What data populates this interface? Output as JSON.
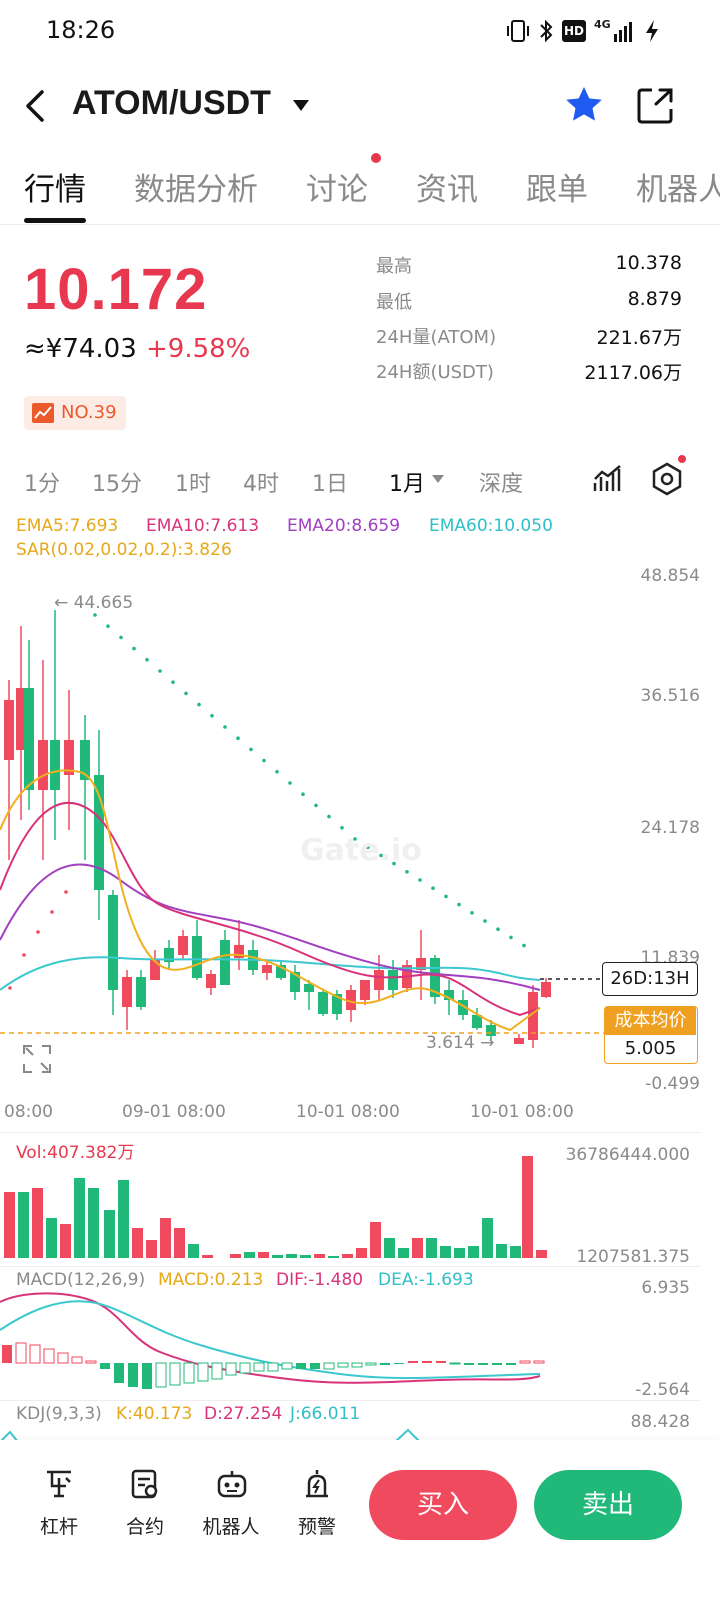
{
  "status_bar": {
    "time": "18:26",
    "icons": [
      "vibrate-icon",
      "bluetooth-icon",
      "hd-icon",
      "4g-signal-icon",
      "battery-charging-icon"
    ],
    "hd_label": "HD",
    "net_label": "4G"
  },
  "header": {
    "pair": "ATOM/USDT",
    "favorite_color": "#1f5bf0"
  },
  "tabs": [
    {
      "label": "行情",
      "active": true
    },
    {
      "label": "数据分析",
      "active": false
    },
    {
      "label": "讨论",
      "active": false,
      "dot": true
    },
    {
      "label": "资讯",
      "active": false
    },
    {
      "label": "跟单",
      "active": false
    },
    {
      "label": "机器人",
      "active": false
    }
  ],
  "ticker": {
    "price": "10.172",
    "cny": "≈¥74.03",
    "change": "+9.58%",
    "rank": "NO.39",
    "stats": [
      {
        "label": "最高",
        "value": "10.378"
      },
      {
        "label": "最低",
        "value": "8.879"
      },
      {
        "label": "24H量(ATOM)",
        "value": "221.67万"
      },
      {
        "label": "24H额(USDT)",
        "value": "2117.06万"
      }
    ]
  },
  "timeframes": [
    {
      "label": "1分",
      "active": false
    },
    {
      "label": "15分",
      "active": false
    },
    {
      "label": "1时",
      "active": false
    },
    {
      "label": "4时",
      "active": false
    },
    {
      "label": "1日",
      "active": false
    },
    {
      "label": "1月",
      "active": true
    },
    {
      "label": "深度",
      "active": false
    }
  ],
  "indicators": {
    "ema5": "EMA5:7.693",
    "ema10": "EMA10:7.613",
    "ema20": "EMA20:8.659",
    "ema60": "EMA60:10.050",
    "sar": "SAR(0.02,0.02,0.2):3.826",
    "colors": {
      "ema5": "#f0b020",
      "ema10": "#d8337a",
      "ema20": "#a23fc0",
      "ema60": "#3cc8cf",
      "sar": "#f0b020"
    }
  },
  "chart": {
    "watermark": "Gate.io",
    "high_marker": "← 44.665",
    "low_marker": "3.614 →",
    "countdown": "26D:13H",
    "cost_label": "成本均价",
    "cost_value": "5.005",
    "price_axis": [
      "48.854",
      "36.516",
      "24.178",
      "11.839",
      "-0.499"
    ],
    "date_axis": [
      "08:00",
      "09-01 08:00",
      "10-01 08:00",
      "10-01 08:00"
    ],
    "up_color": "#ef4a5e",
    "down_color": "#21b97a"
  },
  "volume": {
    "label": "Vol:407.382万",
    "axis_top": "36786444.000",
    "axis_bottom": "1207581.375"
  },
  "macd": {
    "title": "MACD(12,26,9)",
    "macd": "MACD:0.213",
    "dif": "DIF:-1.480",
    "dea": "DEA:-1.693",
    "axis_top": "6.935",
    "axis_bottom": "-2.564"
  },
  "kdj": {
    "title": "KDJ(9,3,3)",
    "k": "K:40.173",
    "d": "D:27.254",
    "j": "J:66.011",
    "axis_top": "88.428"
  },
  "bottom_nav": [
    {
      "label": "杠杆"
    },
    {
      "label": "合约"
    },
    {
      "label": "机器人"
    },
    {
      "label": "预警"
    }
  ],
  "actions": {
    "buy": "买入",
    "sell": "卖出"
  }
}
